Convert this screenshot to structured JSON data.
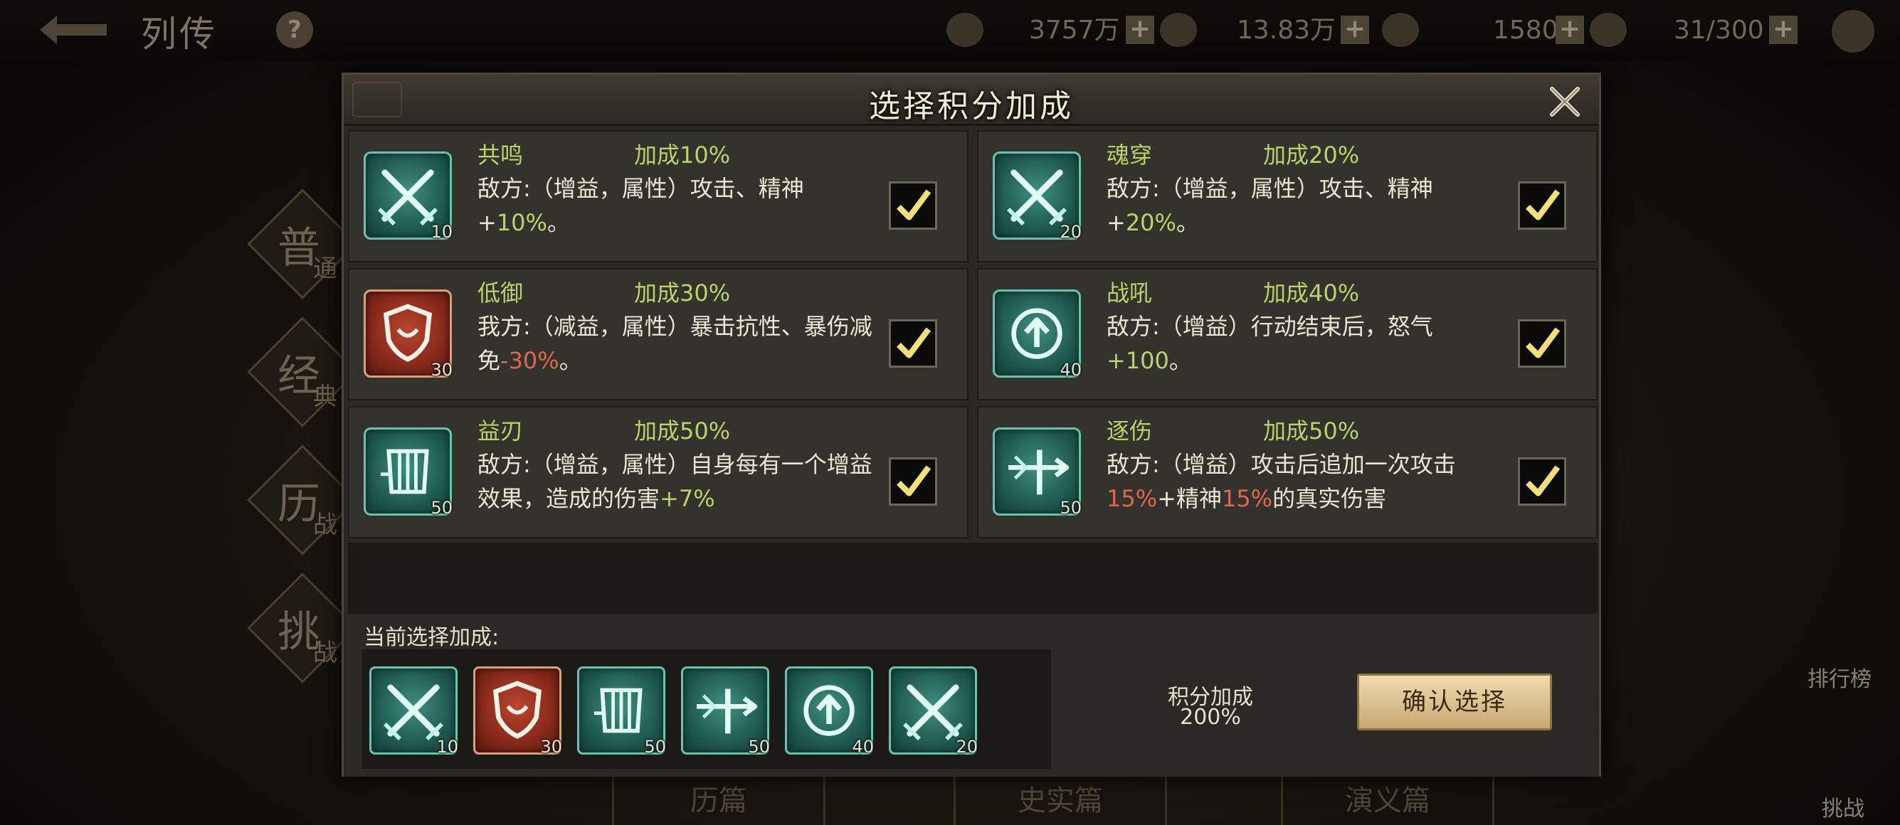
{
  "topbar": {
    "title": "列传",
    "help": "?",
    "res1": "3757万",
    "res2": "13.83万",
    "res3": "1580",
    "res4": "31/300"
  },
  "side_tabs": [
    {
      "main": "普",
      "sub": "通"
    },
    {
      "main": "经",
      "sub": "典"
    },
    {
      "main": "历",
      "sub": "战"
    },
    {
      "main": "挑",
      "sub": "战"
    }
  ],
  "right_items": {
    "rank": "排行榜",
    "challenge": "挑战"
  },
  "bottom_tabs": [
    "历篇",
    "史实篇",
    "演义篇"
  ],
  "modal": {
    "title": "选择积分加成",
    "cards": [
      {
        "name": "共鸣",
        "bonus": "加成10%",
        "desc_pre": "敌方:（增益，属性）攻击、精神+",
        "desc_hi": "10%",
        "desc_post": "。",
        "level": "10",
        "icon": "crossed-swords-icon",
        "color": "teal",
        "checked": true
      },
      {
        "name": "魂穿",
        "bonus": "加成20%",
        "desc_pre": "敌方:（增益，属性）攻击、精神+",
        "desc_hi": "20%",
        "desc_post": "。",
        "level": "20",
        "icon": "crossed-swords-icon",
        "color": "teal",
        "checked": true
      },
      {
        "name": "低御",
        "bonus": "加成30%",
        "desc_pre": "我方:（减益，属性）暴击抗性、暴伤减免",
        "desc_hi": "-30%",
        "desc_post": "。",
        "level": "30",
        "icon": "shield-icon",
        "color": "red",
        "checked": true
      },
      {
        "name": "战吼",
        "bonus": "加成40%",
        "desc_pre": "敌方:（增益）行动结束后，怒气",
        "desc_hi": "+100",
        "desc_post": "。",
        "level": "40",
        "icon": "arrow-up-circle-icon",
        "color": "teal",
        "checked": true
      },
      {
        "name": "益刃",
        "bonus": "加成50%",
        "desc_pre": "敌方:（增益，属性）自身每有一个增益效果，造成的伤害",
        "desc_hi": "+7%",
        "desc_post": "",
        "level": "50",
        "icon": "armor-icon",
        "color": "teal",
        "checked": true
      },
      {
        "name": "逐伤",
        "bonus": "加成50%",
        "desc_pre": "敌方:（增益）攻击后追加一次攻击",
        "desc_hi": "15%",
        "desc_mid": "+精神",
        "desc_hi2": "15%",
        "desc_post": "的真实伤害",
        "level": "50",
        "icon": "sword-arrow-icon",
        "color": "teal",
        "checked": true
      }
    ],
    "current_label": "当前选择加成:",
    "selected": [
      {
        "icon": "crossed-swords-icon",
        "color": "teal",
        "level": "10"
      },
      {
        "icon": "shield-icon",
        "color": "red",
        "level": "30"
      },
      {
        "icon": "armor-icon",
        "color": "teal",
        "level": "50"
      },
      {
        "icon": "sword-arrow-icon",
        "color": "teal",
        "level": "50"
      },
      {
        "icon": "arrow-up-circle-icon",
        "color": "teal",
        "level": "40"
      },
      {
        "icon": "crossed-swords-icon",
        "color": "teal",
        "level": "20"
      }
    ],
    "score_label": "积分加成",
    "score_value": "200%",
    "confirm": "确认选择"
  },
  "colors": {
    "accent_green": "#b7d36a",
    "accent_red": "#e0674f",
    "teal": "#3f8f80"
  }
}
